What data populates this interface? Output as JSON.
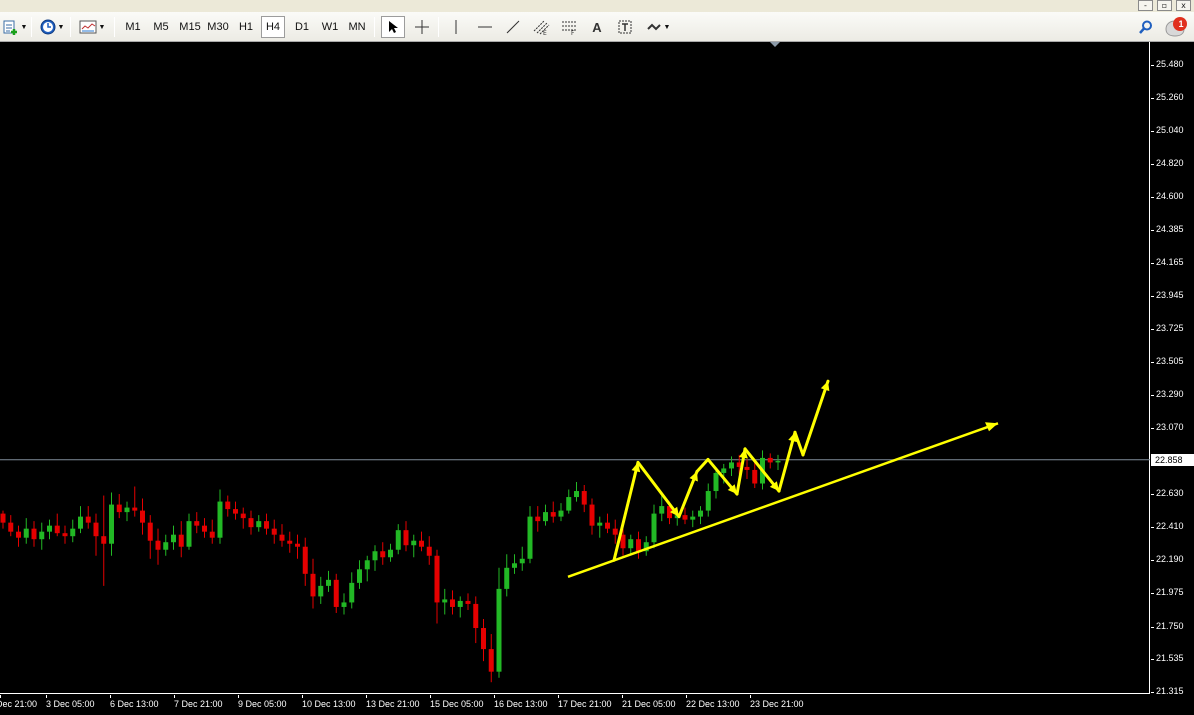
{
  "window_controls": {
    "minimize": "-",
    "restore": "▫",
    "close": "x"
  },
  "toolbar": {
    "new_chart_icon": "new-chart-icon",
    "history_icon": "clock-icon",
    "chart_template_icon": "chart-template-icon",
    "timeframes": [
      "M1",
      "M5",
      "M15",
      "M30",
      "H1",
      "H4",
      "D1",
      "W1",
      "MN"
    ],
    "selected_timeframe": "H4",
    "tools": [
      "cursor-icon",
      "crosshair-icon",
      "vertical-line-icon",
      "horizontal-line-icon",
      "trendline-icon",
      "fibonacci-channel-icon",
      "fibonacci-retracement-icon",
      "text-tool-icon",
      "text-label-icon",
      "arrows-tool-icon"
    ],
    "text_tool_label": "A",
    "search_icon": "search-icon",
    "notification_count": "1"
  },
  "chart_data": {
    "type": "candlestick",
    "price_axis_labels": [
      "25.480",
      "25.260",
      "25.040",
      "24.820",
      "24.600",
      "24.385",
      "24.165",
      "23.945",
      "23.725",
      "23.505",
      "23.290",
      "23.070",
      "22.858",
      "22.630",
      "22.410",
      "22.190",
      "21.975",
      "21.750",
      "21.535",
      "21.315"
    ],
    "price_axis_values": [
      25.48,
      25.26,
      25.04,
      24.82,
      24.6,
      24.385,
      24.165,
      23.945,
      23.725,
      23.505,
      23.29,
      23.07,
      22.63,
      22.41,
      22.19,
      21.975,
      21.75,
      21.535,
      21.315
    ],
    "current_price": "22.858",
    "ylim": [
      21.315,
      25.48
    ],
    "time_axis_labels": [
      "Dec 21:00",
      "3 Dec 05:00",
      "6 Dec 13:00",
      "7 Dec 21:00",
      "9 Dec 05:00",
      "10 Dec 13:00",
      "13 Dec 21:00",
      "15 Dec 05:00",
      "16 Dec 13:00",
      "17 Dec 21:00",
      "21 Dec 05:00",
      "22 Dec 13:00",
      "23 Dec 21:00"
    ],
    "bull_color": "#22b825",
    "bear_color": "#e60000",
    "candles": [
      [
        22.5,
        22.52,
        22.4,
        22.44
      ],
      [
        22.44,
        22.49,
        22.35,
        22.38
      ],
      [
        22.38,
        22.42,
        22.28,
        22.34
      ],
      [
        22.34,
        22.47,
        22.3,
        22.4
      ],
      [
        22.4,
        22.45,
        22.28,
        22.33
      ],
      [
        22.33,
        22.44,
        22.26,
        22.38
      ],
      [
        22.38,
        22.46,
        22.33,
        22.42
      ],
      [
        22.42,
        22.5,
        22.35,
        22.37
      ],
      [
        22.37,
        22.42,
        22.3,
        22.35
      ],
      [
        22.35,
        22.46,
        22.31,
        22.4
      ],
      [
        22.4,
        22.55,
        22.37,
        22.48
      ],
      [
        22.48,
        22.55,
        22.4,
        22.44
      ],
      [
        22.44,
        22.5,
        22.22,
        22.35
      ],
      [
        22.35,
        22.62,
        22.02,
        22.3
      ],
      [
        22.3,
        22.64,
        22.22,
        22.56
      ],
      [
        22.56,
        22.63,
        22.47,
        22.51
      ],
      [
        22.51,
        22.58,
        22.45,
        22.54
      ],
      [
        22.54,
        22.68,
        22.48,
        22.52
      ],
      [
        22.52,
        22.6,
        22.36,
        22.44
      ],
      [
        22.44,
        22.49,
        22.2,
        22.32
      ],
      [
        22.32,
        22.4,
        22.16,
        22.26
      ],
      [
        22.26,
        22.36,
        22.22,
        22.31
      ],
      [
        22.31,
        22.42,
        22.26,
        22.36
      ],
      [
        22.36,
        22.45,
        22.21,
        22.28
      ],
      [
        22.28,
        22.5,
        22.26,
        22.45
      ],
      [
        22.45,
        22.51,
        22.37,
        22.42
      ],
      [
        22.42,
        22.47,
        22.34,
        22.38
      ],
      [
        22.38,
        22.46,
        22.3,
        22.34
      ],
      [
        22.34,
        22.66,
        22.3,
        22.58
      ],
      [
        22.58,
        22.62,
        22.48,
        22.53
      ],
      [
        22.53,
        22.58,
        22.46,
        22.5
      ],
      [
        22.5,
        22.54,
        22.4,
        22.47
      ],
      [
        22.47,
        22.52,
        22.36,
        22.41
      ],
      [
        22.41,
        22.49,
        22.38,
        22.45
      ],
      [
        22.45,
        22.5,
        22.36,
        22.4
      ],
      [
        22.4,
        22.46,
        22.3,
        22.36
      ],
      [
        22.36,
        22.43,
        22.28,
        22.32
      ],
      [
        22.32,
        22.38,
        22.24,
        22.3
      ],
      [
        22.3,
        22.36,
        22.2,
        22.28
      ],
      [
        22.28,
        22.34,
        22.02,
        22.1
      ],
      [
        22.1,
        22.2,
        21.87,
        21.95
      ],
      [
        21.95,
        22.08,
        21.9,
        22.02
      ],
      [
        22.02,
        22.12,
        21.98,
        22.06
      ],
      [
        22.06,
        22.1,
        21.84,
        21.88
      ],
      [
        21.88,
        21.97,
        21.83,
        21.91
      ],
      [
        21.91,
        22.11,
        21.87,
        22.04
      ],
      [
        22.04,
        22.19,
        22.0,
        22.13
      ],
      [
        22.13,
        22.22,
        22.05,
        22.19
      ],
      [
        22.19,
        22.29,
        22.12,
        22.25
      ],
      [
        22.25,
        22.31,
        22.16,
        22.21
      ],
      [
        22.21,
        22.3,
        22.18,
        22.26
      ],
      [
        22.26,
        22.43,
        22.23,
        22.39
      ],
      [
        22.39,
        22.45,
        22.25,
        22.29
      ],
      [
        22.29,
        22.36,
        22.21,
        22.32
      ],
      [
        22.32,
        22.38,
        22.25,
        22.28
      ],
      [
        22.28,
        22.35,
        22.16,
        22.22
      ],
      [
        22.22,
        22.26,
        21.77,
        21.91
      ],
      [
        21.91,
        22.0,
        21.83,
        21.93
      ],
      [
        21.93,
        21.99,
        21.83,
        21.88
      ],
      [
        21.88,
        21.95,
        21.81,
        21.92
      ],
      [
        21.92,
        21.97,
        21.86,
        21.9
      ],
      [
        21.9,
        21.95,
        21.64,
        21.74
      ],
      [
        21.74,
        21.8,
        21.52,
        21.6
      ],
      [
        21.6,
        21.7,
        21.38,
        21.45
      ],
      [
        21.45,
        22.14,
        21.41,
        22.0
      ],
      [
        22.0,
        22.23,
        21.95,
        22.14
      ],
      [
        22.14,
        22.23,
        22.1,
        22.17
      ],
      [
        22.17,
        22.28,
        22.12,
        22.2
      ],
      [
        22.2,
        22.55,
        22.17,
        22.48
      ],
      [
        22.48,
        22.55,
        22.38,
        22.45
      ],
      [
        22.45,
        22.56,
        22.42,
        22.51
      ],
      [
        22.51,
        22.58,
        22.44,
        22.48
      ],
      [
        22.48,
        22.57,
        22.45,
        22.52
      ],
      [
        22.52,
        22.66,
        22.5,
        22.61
      ],
      [
        22.61,
        22.71,
        22.58,
        22.65
      ],
      [
        22.65,
        22.69,
        22.51,
        22.56
      ],
      [
        22.56,
        22.6,
        22.36,
        22.42
      ],
      [
        22.42,
        22.48,
        22.34,
        22.44
      ],
      [
        22.44,
        22.5,
        22.37,
        22.4
      ],
      [
        22.4,
        22.46,
        22.3,
        22.36
      ],
      [
        22.36,
        22.4,
        22.22,
        22.27
      ],
      [
        22.27,
        22.36,
        22.23,
        22.33
      ],
      [
        22.33,
        22.38,
        22.2,
        22.25
      ],
      [
        22.25,
        22.35,
        22.22,
        22.31
      ],
      [
        22.31,
        22.56,
        22.27,
        22.5
      ],
      [
        22.5,
        22.62,
        22.45,
        22.55
      ],
      [
        22.55,
        22.58,
        22.43,
        22.47
      ],
      [
        22.47,
        22.52,
        22.42,
        22.49
      ],
      [
        22.49,
        22.54,
        22.43,
        22.46
      ],
      [
        22.46,
        22.52,
        22.41,
        22.48
      ],
      [
        22.48,
        22.55,
        22.43,
        22.52
      ],
      [
        22.52,
        22.7,
        22.48,
        22.65
      ],
      [
        22.65,
        22.81,
        22.6,
        22.77
      ],
      [
        22.77,
        22.83,
        22.7,
        22.8
      ],
      [
        22.8,
        22.88,
        22.75,
        22.84
      ],
      [
        22.84,
        22.89,
        22.76,
        22.81
      ],
      [
        22.81,
        22.86,
        22.73,
        22.79
      ],
      [
        22.79,
        22.84,
        22.67,
        22.7
      ],
      [
        22.7,
        22.92,
        22.66,
        22.87
      ],
      [
        22.87,
        22.9,
        22.8,
        22.84
      ],
      [
        22.84,
        22.89,
        22.79,
        22.85
      ]
    ],
    "drawn_objects": {
      "trendline": {
        "color": "#ffff00",
        "from": [
          17.05,
          22.08
        ],
        "to": [
          24.6,
          23.1
        ]
      },
      "projection_arrow_color": "#ffff00"
    }
  }
}
